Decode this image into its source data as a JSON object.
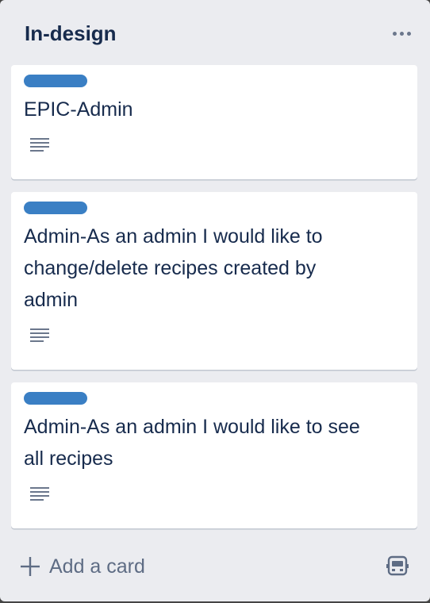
{
  "list": {
    "title": "In-design",
    "menu_icon": "ellipsis-icon",
    "cards": [
      {
        "label_color": "#3a7fc4",
        "title": "EPIC-Admin",
        "badge_icon": "description-icon"
      },
      {
        "label_color": "#3a7fc4",
        "title": "Admin-As an admin I would like to\nchange/delete recipes created by\nadmin",
        "badge_icon": "description-icon"
      },
      {
        "label_color": "#3a7fc4",
        "title": "Admin-As an admin I would like to see\nall recipes",
        "badge_icon": "description-icon"
      }
    ],
    "composer": {
      "add_label": "Add a card",
      "add_icon": "plus-icon",
      "template_icon": "card-template-icon"
    }
  }
}
